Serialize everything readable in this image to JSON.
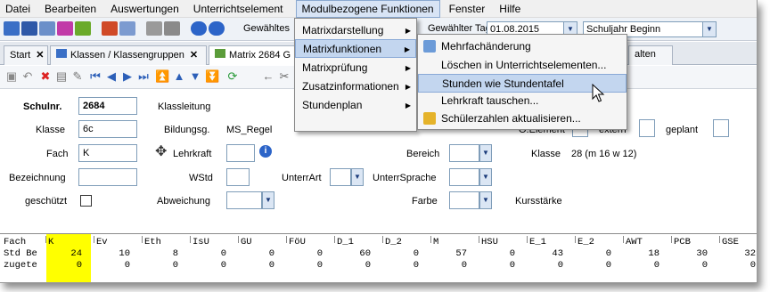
{
  "menubar": {
    "items": [
      "Datei",
      "Bearbeiten",
      "Auswertungen",
      "Unterrichtselement",
      "Modulbezogene Funktionen",
      "Fenster",
      "Hilfe"
    ]
  },
  "toolbar": {
    "selected_label": "Gewähltes",
    "selected_day_label": "Gewählter Tag",
    "selected_day_value": "01.08.2015",
    "period_value": "Schuljahr Beginn"
  },
  "tabs": [
    "Start",
    "Klassen / Klassengruppen",
    "Matrix 2684 G",
    "alten"
  ],
  "form": {
    "schulnr_label": "Schulnr.",
    "schulnr_value": "2684",
    "klassleitung_label": "Klassleitung",
    "klasse_label": "Klasse",
    "klasse_value": "6c",
    "bildungsg_label": "Bildungsg.",
    "bildungsg_value": "MS_Regel",
    "fach_label": "Fach",
    "fach_value": "K",
    "lehrkraft_label": "Lehrkraft",
    "bereich_label": "Bereich",
    "klasse_info_label": "Klasse",
    "klasse_info_value": "28 (m 16 w 12)",
    "bezeichnung_label": "Bezeichnung",
    "wstd_label": "WStd",
    "unterrart_label": "UnterrArt",
    "unterrsprache_label": "UnterrSprache",
    "geschuetzt_label": "geschützt",
    "abweichung_label": "Abweichung",
    "farbe_label": "Farbe",
    "kursstaerke_label": "Kursstärke",
    "oelement_label": "O.Element",
    "extern_label": "extern",
    "geplant_label": "geplant"
  },
  "grid": {
    "row_labels": [
      "Fach",
      "Std Be",
      "zugete"
    ],
    "columns": [
      {
        "name": "K",
        "std": "24",
        "zu": "0"
      },
      {
        "name": "Ev",
        "std": "10",
        "zu": "0"
      },
      {
        "name": "Eth",
        "std": "8",
        "zu": "0"
      },
      {
        "name": "IsU",
        "std": "0",
        "zu": "0"
      },
      {
        "name": "GU",
        "std": "0",
        "zu": "0"
      },
      {
        "name": "FöU",
        "std": "0",
        "zu": "0"
      },
      {
        "name": "D_1",
        "std": "60",
        "zu": "0"
      },
      {
        "name": "D_2",
        "std": "0",
        "zu": "0"
      },
      {
        "name": "M",
        "std": "57",
        "zu": "0"
      },
      {
        "name": "HSU",
        "std": "0",
        "zu": "0"
      },
      {
        "name": "E_1",
        "std": "43",
        "zu": "0"
      },
      {
        "name": "E_2",
        "std": "0",
        "zu": "0"
      },
      {
        "name": "AWT",
        "std": "18",
        "zu": "0"
      },
      {
        "name": "PCB",
        "std": "30",
        "zu": "0"
      },
      {
        "name": "GSE",
        "std": "32",
        "zu": "0"
      }
    ]
  },
  "menu1": {
    "items": [
      "Matrixdarstellung",
      "Matrixfunktionen",
      "Matrixprüfung",
      "Zusatzinformationen",
      "Stundenplan"
    ]
  },
  "menu2": {
    "items": [
      "Mehrfachänderung",
      "Löschen in Unterrichtselementen...",
      "Stunden wie Stundentafel",
      "Lehrkraft tauschen...",
      "Schülerzahlen aktualisieren..."
    ]
  },
  "colors": {
    "highlight_yellow": "#ffff00",
    "menu_highlight": "#c3d6ef"
  }
}
